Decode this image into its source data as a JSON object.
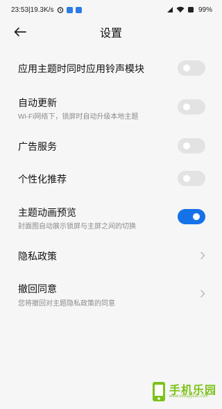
{
  "status_bar": {
    "time_speed": "23:53|19.3K/s",
    "battery": "99%"
  },
  "header": {
    "title": "设置"
  },
  "settings": [
    {
      "main": "应用主题时同时应用铃声模块",
      "toggle_on": false
    },
    {
      "main": "自动更新",
      "sub": "Wi-Fi网络下，锁屏时自动升级本地主题",
      "toggle_on": false
    },
    {
      "main": "广告服务",
      "toggle_on": false
    },
    {
      "main": "个性化推荐",
      "toggle_on": false
    },
    {
      "main": "主题动画预览",
      "sub": "封面图自动展示锁屏与主屏之间的切换",
      "toggle_on": true
    },
    {
      "main": "隐私政策"
    },
    {
      "main": "撤回同意",
      "sub": "您将撤回对主题隐私政策的同意"
    }
  ],
  "watermark": {
    "name": "手机乐园",
    "url": "www.shoujiyuan.com"
  },
  "colors": {
    "accent": "#1572e8",
    "toggle_off": "#e3e3e3"
  }
}
